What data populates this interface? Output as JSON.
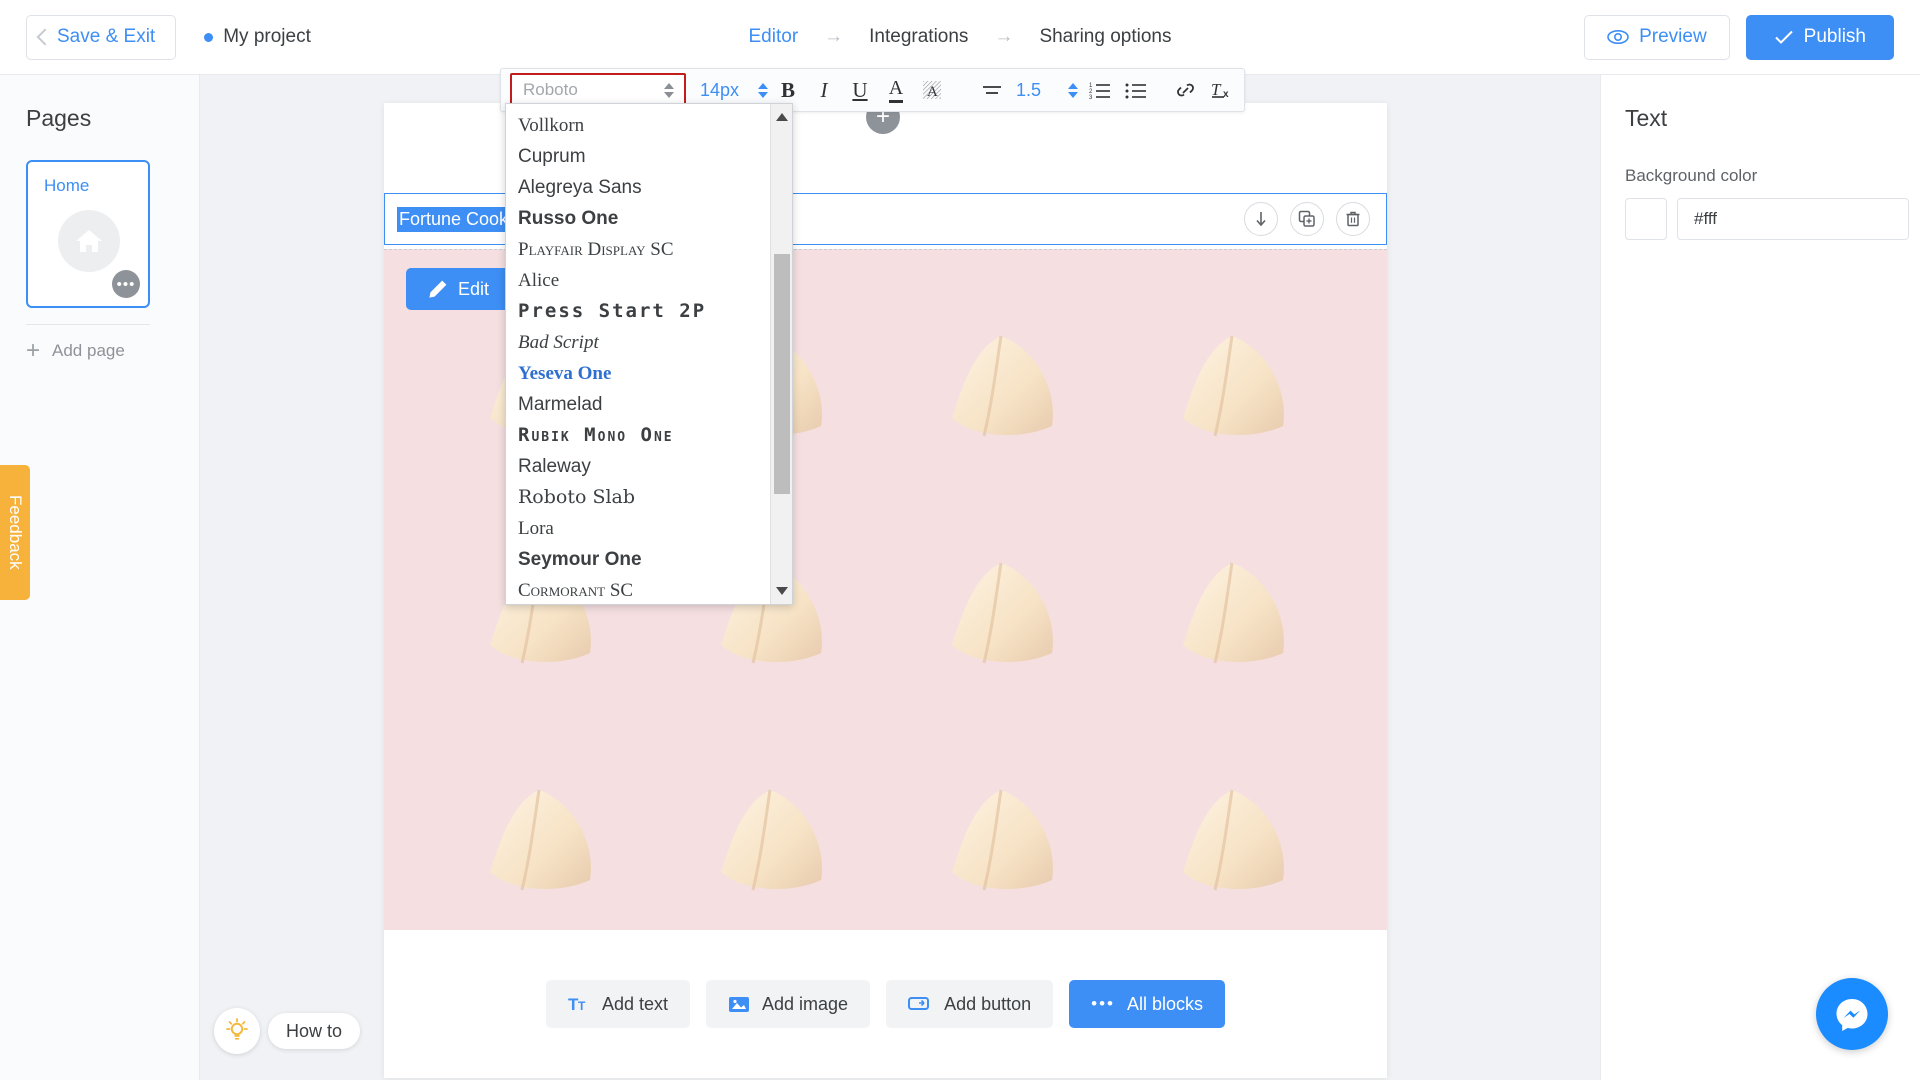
{
  "topbar": {
    "save_exit": "Save & Exit",
    "project_name": "My project",
    "steps": [
      {
        "label": "Editor",
        "active": true
      },
      {
        "label": "Integrations",
        "active": false
      },
      {
        "label": "Sharing options",
        "active": false
      }
    ],
    "arrow": "→",
    "preview": "Preview",
    "publish": "Publish",
    "accent_color": "#3d8ef5"
  },
  "sidebar_left": {
    "title": "Pages",
    "page": {
      "name": "Home",
      "menu_dots": "•••"
    },
    "add_page": "Add page",
    "feedback": "Feedback",
    "how_to": "How to"
  },
  "sidebar_right": {
    "title": "Text",
    "background_color_label": "Background color",
    "background_color_value": "#fff",
    "swatch_color": "#ffffff"
  },
  "toolbar": {
    "font_placeholder": "Roboto",
    "font_size": "14px",
    "line_height": "1.5",
    "bold": "B",
    "italic": "I",
    "underline": "U",
    "text_color": "A",
    "highlight_color": "A",
    "align": "align-icon",
    "ordered_list": "ordered-list-icon",
    "bullet_list": "bullet-list-icon",
    "link": "link-icon",
    "clear_format": "Tx",
    "border_color": "#c21d1d"
  },
  "font_dropdown": {
    "items": [
      {
        "name": "Vollkorn",
        "face": "f-serif"
      },
      {
        "name": "Cuprum",
        "face": "f-sans"
      },
      {
        "name": "Alegreya Sans",
        "face": "f-sans"
      },
      {
        "name": "Russo One",
        "face": "f-sans f-bold"
      },
      {
        "name": "Playfair Display SC",
        "face": "f-serif f-sc"
      },
      {
        "name": "Alice",
        "face": "f-serif"
      },
      {
        "name": "Press Start 2P",
        "face": "f-mono f-bold f-wide"
      },
      {
        "name": "Bad Script",
        "face": "f-serif f-italic"
      },
      {
        "name": "Yeseva One",
        "face": "f-serif f-bold",
        "highlight": true
      },
      {
        "name": "Marmelad",
        "face": "f-sans"
      },
      {
        "name": "Rubik Mono One",
        "face": "f-mono f-bold f-sc f-wide"
      },
      {
        "name": "Raleway",
        "face": "f-sans"
      },
      {
        "name": "Roboto Slab",
        "face": "f-dserif"
      },
      {
        "name": "Lora",
        "face": "f-serif"
      },
      {
        "name": "Seymour One",
        "face": "f-sans f-bold"
      },
      {
        "name": "Cormorant SC",
        "face": "f-serif f-sc"
      }
    ]
  },
  "canvas": {
    "selected_text": "Fortune Cook",
    "edit_button": "Edit",
    "block_controls": [
      "move-down",
      "duplicate",
      "delete"
    ],
    "image_background": "#f5dfe1",
    "bottom_bar": [
      {
        "label": "Add text",
        "icon": "text-icon",
        "primary": false
      },
      {
        "label": "Add image",
        "icon": "image-icon",
        "primary": false
      },
      {
        "label": "Add button",
        "icon": "button-icon",
        "primary": false
      },
      {
        "label": "All blocks",
        "icon": "dots-icon",
        "primary": true
      }
    ]
  }
}
